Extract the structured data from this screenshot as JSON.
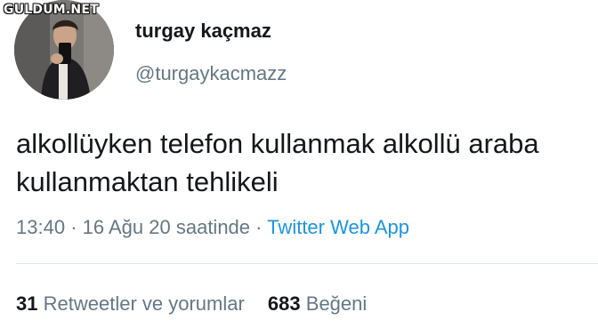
{
  "watermark": "GULDUM.NET",
  "author": {
    "display_name": "turgay kaçmaz",
    "handle": "@turgaykacmazz"
  },
  "tweet": {
    "lines": [
      "alkollüyken telefon kullanmak alkollü araba",
      "kullanmaktan tehlikeli"
    ],
    "time": "13:40",
    "separator": "·",
    "date": "16 Ağu 20 saatinde",
    "source": "Twitter Web App"
  },
  "stats": {
    "retweets_count": "31",
    "retweets_label": "Retweetler ve yorumlar",
    "likes_count": "683",
    "likes_label": "Beğeni"
  },
  "colors": {
    "text": "#14171a",
    "secondary": "#657786",
    "link": "#1b95e0",
    "divider": "#e1e8ed"
  }
}
